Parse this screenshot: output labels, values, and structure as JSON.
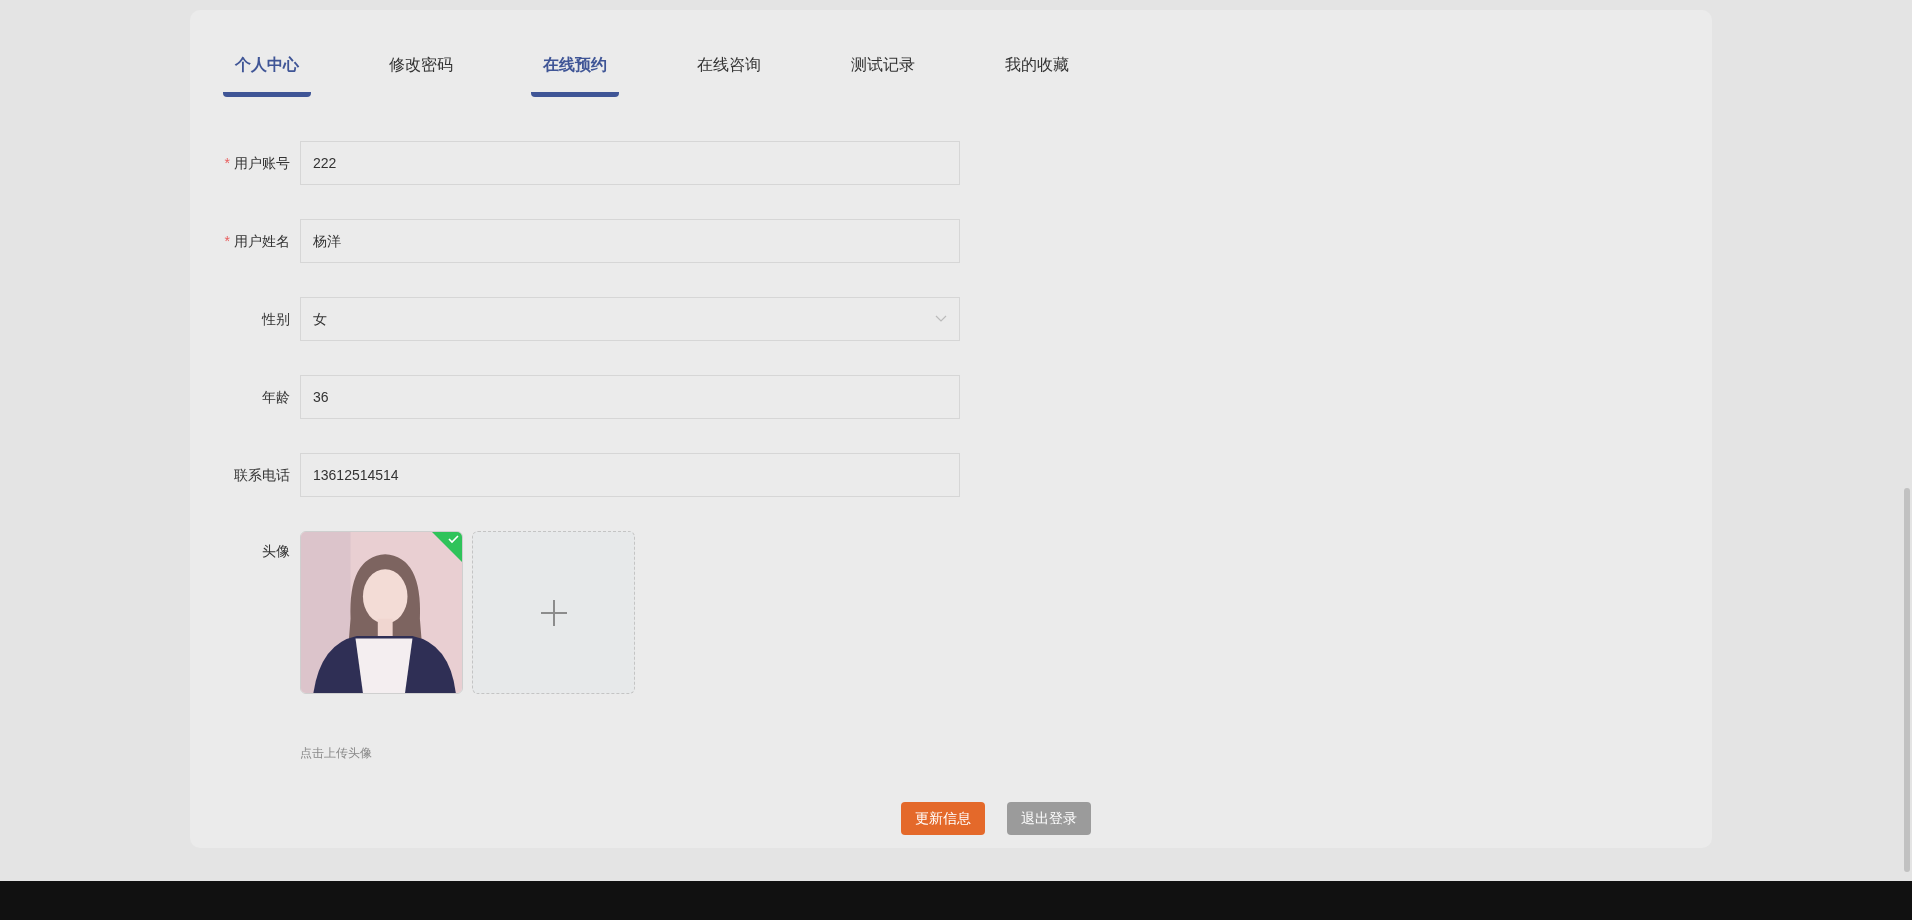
{
  "tabs": [
    {
      "label": "个人中心",
      "selected": true
    },
    {
      "label": "修改密码",
      "selected": false
    },
    {
      "label": "在线预约",
      "selected": true
    },
    {
      "label": "在线咨询",
      "selected": false
    },
    {
      "label": "测试记录",
      "selected": false
    },
    {
      "label": "我的收藏",
      "selected": false
    }
  ],
  "fields": [
    {
      "label": "用户账号",
      "required_mark": "*",
      "kind": "input",
      "value": "222"
    },
    {
      "label": "用户姓名",
      "required_mark": "*",
      "kind": "input",
      "value": "杨洋"
    },
    {
      "label": "性别",
      "kind": "select",
      "value": "女"
    },
    {
      "label": "年龄",
      "kind": "input",
      "value": "36"
    },
    {
      "label": "联系电话",
      "kind": "input",
      "value": "13612514514"
    }
  ],
  "avatar": {
    "label": "头像",
    "uploaded": true,
    "hint": "点击上传头像"
  },
  "buttons": [
    {
      "label": "更新信息",
      "kind": "primary"
    },
    {
      "label": "退出登录",
      "kind": "secondary"
    }
  ]
}
